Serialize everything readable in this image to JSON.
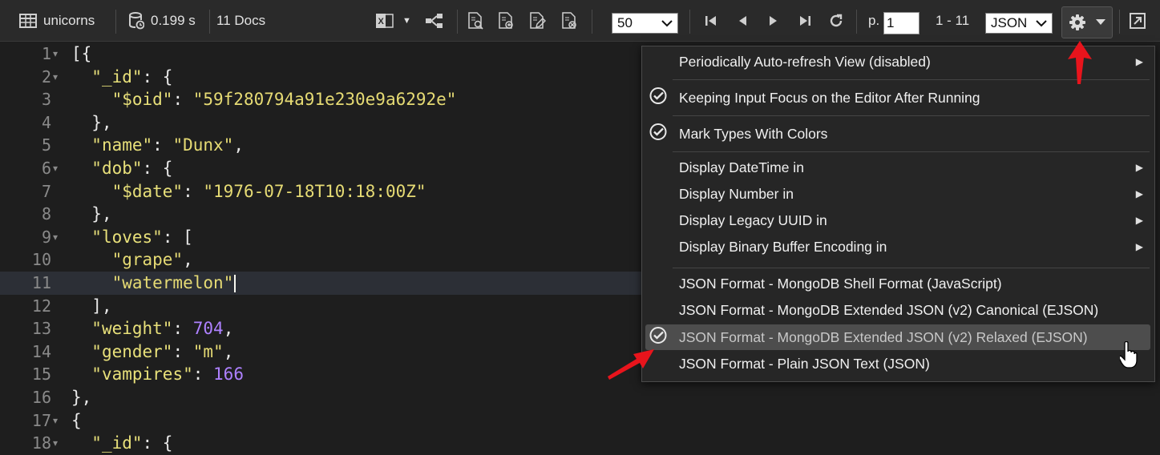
{
  "toolbar": {
    "collection": "unicorns",
    "time": "0.199 s",
    "docs": "11 Docs",
    "page_size": "50",
    "page_label": "p.",
    "page_value": "1",
    "range": "1 - 11",
    "view_mode": "JSON"
  },
  "editor": {
    "active_line": 11,
    "lines": [
      {
        "num": "1",
        "fold": true
      },
      {
        "num": "2",
        "fold": true
      },
      {
        "num": "3",
        "fold": false
      },
      {
        "num": "4",
        "fold": false
      },
      {
        "num": "5",
        "fold": false
      },
      {
        "num": "6",
        "fold": true
      },
      {
        "num": "7",
        "fold": false
      },
      {
        "num": "8",
        "fold": false
      },
      {
        "num": "9",
        "fold": true
      },
      {
        "num": "10",
        "fold": false
      },
      {
        "num": "11",
        "fold": false
      },
      {
        "num": "12",
        "fold": false
      },
      {
        "num": "13",
        "fold": false
      },
      {
        "num": "14",
        "fold": false
      },
      {
        "num": "15",
        "fold": false
      },
      {
        "num": "16",
        "fold": false
      },
      {
        "num": "17",
        "fold": true
      },
      {
        "num": "18",
        "fold": true
      }
    ],
    "code": [
      [
        {
          "t": "p",
          "v": "[{"
        }
      ],
      [
        {
          "t": "p",
          "v": "  "
        },
        {
          "t": "k",
          "v": "\"_id\""
        },
        {
          "t": "p",
          "v": ": {"
        }
      ],
      [
        {
          "t": "p",
          "v": "    "
        },
        {
          "t": "k",
          "v": "\"$oid\""
        },
        {
          "t": "p",
          "v": ": "
        },
        {
          "t": "s",
          "v": "\"59f280794a91e230e9a6292e\""
        }
      ],
      [
        {
          "t": "p",
          "v": "  },"
        }
      ],
      [
        {
          "t": "p",
          "v": "  "
        },
        {
          "t": "k",
          "v": "\"name\""
        },
        {
          "t": "p",
          "v": ": "
        },
        {
          "t": "s",
          "v": "\"Dunx\""
        },
        {
          "t": "p",
          "v": ","
        }
      ],
      [
        {
          "t": "p",
          "v": "  "
        },
        {
          "t": "k",
          "v": "\"dob\""
        },
        {
          "t": "p",
          "v": ": {"
        }
      ],
      [
        {
          "t": "p",
          "v": "    "
        },
        {
          "t": "k",
          "v": "\"$date\""
        },
        {
          "t": "p",
          "v": ": "
        },
        {
          "t": "s",
          "v": "\"1976-07-18T10:18:00Z\""
        }
      ],
      [
        {
          "t": "p",
          "v": "  },"
        }
      ],
      [
        {
          "t": "p",
          "v": "  "
        },
        {
          "t": "k",
          "v": "\"loves\""
        },
        {
          "t": "p",
          "v": ": ["
        }
      ],
      [
        {
          "t": "p",
          "v": "    "
        },
        {
          "t": "s",
          "v": "\"grape\""
        },
        {
          "t": "p",
          "v": ","
        }
      ],
      [
        {
          "t": "p",
          "v": "    "
        },
        {
          "t": "s",
          "v": "\"watermelon\""
        }
      ],
      [
        {
          "t": "p",
          "v": "  ],"
        }
      ],
      [
        {
          "t": "p",
          "v": "  "
        },
        {
          "t": "k",
          "v": "\"weight\""
        },
        {
          "t": "p",
          "v": ": "
        },
        {
          "t": "n",
          "v": "704"
        },
        {
          "t": "p",
          "v": ","
        }
      ],
      [
        {
          "t": "p",
          "v": "  "
        },
        {
          "t": "k",
          "v": "\"gender\""
        },
        {
          "t": "p",
          "v": ": "
        },
        {
          "t": "s",
          "v": "\"m\""
        },
        {
          "t": "p",
          "v": ","
        }
      ],
      [
        {
          "t": "p",
          "v": "  "
        },
        {
          "t": "k",
          "v": "\"vampires\""
        },
        {
          "t": "p",
          "v": ": "
        },
        {
          "t": "n",
          "v": "166"
        }
      ],
      [
        {
          "t": "p",
          "v": "},"
        }
      ],
      [
        {
          "t": "p",
          "v": "{"
        }
      ],
      [
        {
          "t": "p",
          "v": "  "
        },
        {
          "t": "k",
          "v": "\"_id\""
        },
        {
          "t": "p",
          "v": ": {"
        }
      ]
    ]
  },
  "menu": {
    "items": [
      {
        "label": "Periodically Auto-refresh View (disabled)",
        "checked": false,
        "submenu": true
      },
      {
        "label": "Keeping Input Focus on the Editor After Running",
        "checked": true,
        "submenu": false
      },
      {
        "label": "Mark Types With Colors",
        "checked": true,
        "submenu": false
      },
      {
        "label": "Display DateTime in",
        "checked": false,
        "submenu": true
      },
      {
        "label": "Display Number in",
        "checked": false,
        "submenu": true
      },
      {
        "label": "Display Legacy UUID in",
        "checked": false,
        "submenu": true
      },
      {
        "label": "Display Binary Buffer Encoding in",
        "checked": false,
        "submenu": true
      },
      {
        "label": "JSON Format - MongoDB Shell Format (JavaScript)",
        "checked": false,
        "submenu": false
      },
      {
        "label": "JSON Format - MongoDB Extended JSON (v2) Canonical (EJSON)",
        "checked": false,
        "submenu": false
      },
      {
        "label": "JSON Format - MongoDB Extended JSON (v2) Relaxed (EJSON)",
        "checked": true,
        "submenu": false,
        "highlighted": true
      },
      {
        "label": "JSON Format - Plain JSON Text (JSON)",
        "checked": false,
        "submenu": false
      }
    ]
  },
  "colors": {
    "key": "#e8e07a",
    "string": "#e6db74",
    "number": "#ae81ff",
    "annotation_arrow": "#e8141c"
  }
}
